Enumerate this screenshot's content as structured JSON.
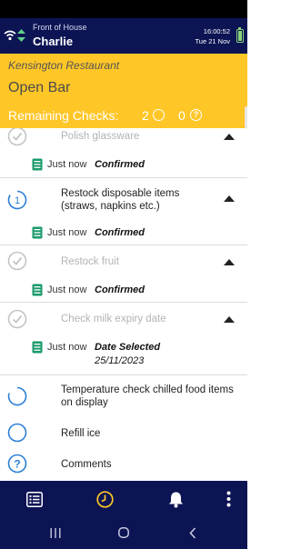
{
  "app": {
    "context": "Front of House",
    "user": "Charlie",
    "time": "16:00:52",
    "date": "Tue 21 Nov"
  },
  "banner": {
    "venue": "Kensington Restaurant",
    "area": "Open Bar",
    "remaining_label": "Remaining Checks:",
    "pending_count": "2",
    "unknown_count": "0",
    "unknown_symbol": "?"
  },
  "tasks": [
    {
      "title": "Polish glassware",
      "state": "done",
      "log": {
        "time": "Just now",
        "status": "Confirmed"
      }
    },
    {
      "title": "Restock disposable items (straws, napkins etc.)",
      "state": "count-1",
      "badge": "1",
      "log": {
        "time": "Just now",
        "status": "Confirmed"
      }
    },
    {
      "title": "Restock fruit",
      "state": "done",
      "log": {
        "time": "Just now",
        "status": "Confirmed"
      }
    },
    {
      "title": "Check milk expiry date",
      "state": "done",
      "log": {
        "time": "Just now",
        "status": "Date Selected",
        "value": "25/11/2023"
      }
    },
    {
      "title": "Temperature check chilled food items on display",
      "state": "pending"
    },
    {
      "title": "Refill ice",
      "state": "open"
    },
    {
      "title": "Comments",
      "state": "question",
      "badge": "?"
    }
  ],
  "nav": {
    "items": [
      "checklist-icon",
      "history-icon",
      "notifications-icon",
      "more-icon"
    ],
    "active": "history-icon",
    "system": [
      "recent-apps-icon",
      "home-icon",
      "back-icon"
    ]
  },
  "colors": {
    "navy": "#0c1454",
    "yellow": "#ffc627",
    "accent_blue": "#2a7fd6",
    "log_green": "#1a9a6a"
  }
}
